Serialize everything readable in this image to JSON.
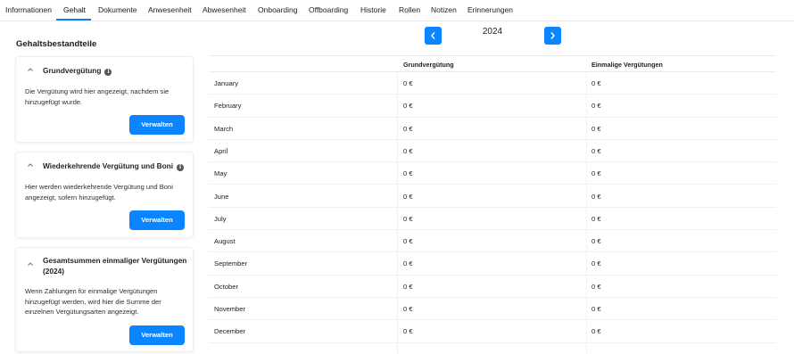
{
  "tabs": [
    {
      "label": "Informationen"
    },
    {
      "label": "Gehalt"
    },
    {
      "label": "Dokumente"
    },
    {
      "label": "Anwesenheit"
    },
    {
      "label": "Abwesenheit"
    },
    {
      "label": "Onboarding"
    },
    {
      "label": "Offboarding"
    },
    {
      "label": "Historie"
    },
    {
      "label": "Rollen"
    },
    {
      "label": "Notizen"
    },
    {
      "label": "Erinnerungen"
    }
  ],
  "active_tab": "Gehalt",
  "section_title": "Gehaltsbestandteile",
  "cards": [
    {
      "title": "Grundvergütung",
      "has_info": true,
      "text": "Die Vergütung wird hier angezeigt, nachdem sie hinzugefügt wurde.",
      "button": "Verwalten"
    },
    {
      "title": "Wiederkehrende Vergütung und Boni",
      "has_info": true,
      "text": "Hier werden wiederkehrende Vergütung und Boni angezeigt, sofern hinzugefügt.",
      "button": "Verwalten"
    },
    {
      "title": "Gesamtsummen einmaliger Vergütungen (2024)",
      "has_info": false,
      "text": "Wenn Zahlungen für einmalige Vergütungen hinzugefügt werden, wird hier die Summe der einzelnen Vergütungsarten angezeigt.",
      "button": "Verwalten"
    }
  ],
  "year_nav": {
    "year": "2024",
    "prev_icon": "chevron-left-icon",
    "next_icon": "chevron-right-icon"
  },
  "table": {
    "headers": [
      "",
      "Grundvergütung",
      "Einmalige Vergütungen"
    ],
    "rows": [
      {
        "month": "January",
        "grund": "0 €",
        "einmalig": "0 €"
      },
      {
        "month": "February",
        "grund": "0 €",
        "einmalig": "0 €"
      },
      {
        "month": "March",
        "grund": "0 €",
        "einmalig": "0 €"
      },
      {
        "month": "April",
        "grund": "0 €",
        "einmalig": "0 €"
      },
      {
        "month": "May",
        "grund": "0 €",
        "einmalig": "0 €"
      },
      {
        "month": "June",
        "grund": "0 €",
        "einmalig": "0 €"
      },
      {
        "month": "July",
        "grund": "0 €",
        "einmalig": "0 €"
      },
      {
        "month": "August",
        "grund": "0 €",
        "einmalig": "0 €"
      },
      {
        "month": "September",
        "grund": "0 €",
        "einmalig": "0 €"
      },
      {
        "month": "October",
        "grund": "0 €",
        "einmalig": "0 €"
      },
      {
        "month": "November",
        "grund": "0 €",
        "einmalig": "0 €"
      },
      {
        "month": "December",
        "grund": "0 €",
        "einmalig": "0 €"
      }
    ]
  },
  "colors": {
    "accent": "#0a84ff",
    "tab_underline": "#0a7cff"
  }
}
